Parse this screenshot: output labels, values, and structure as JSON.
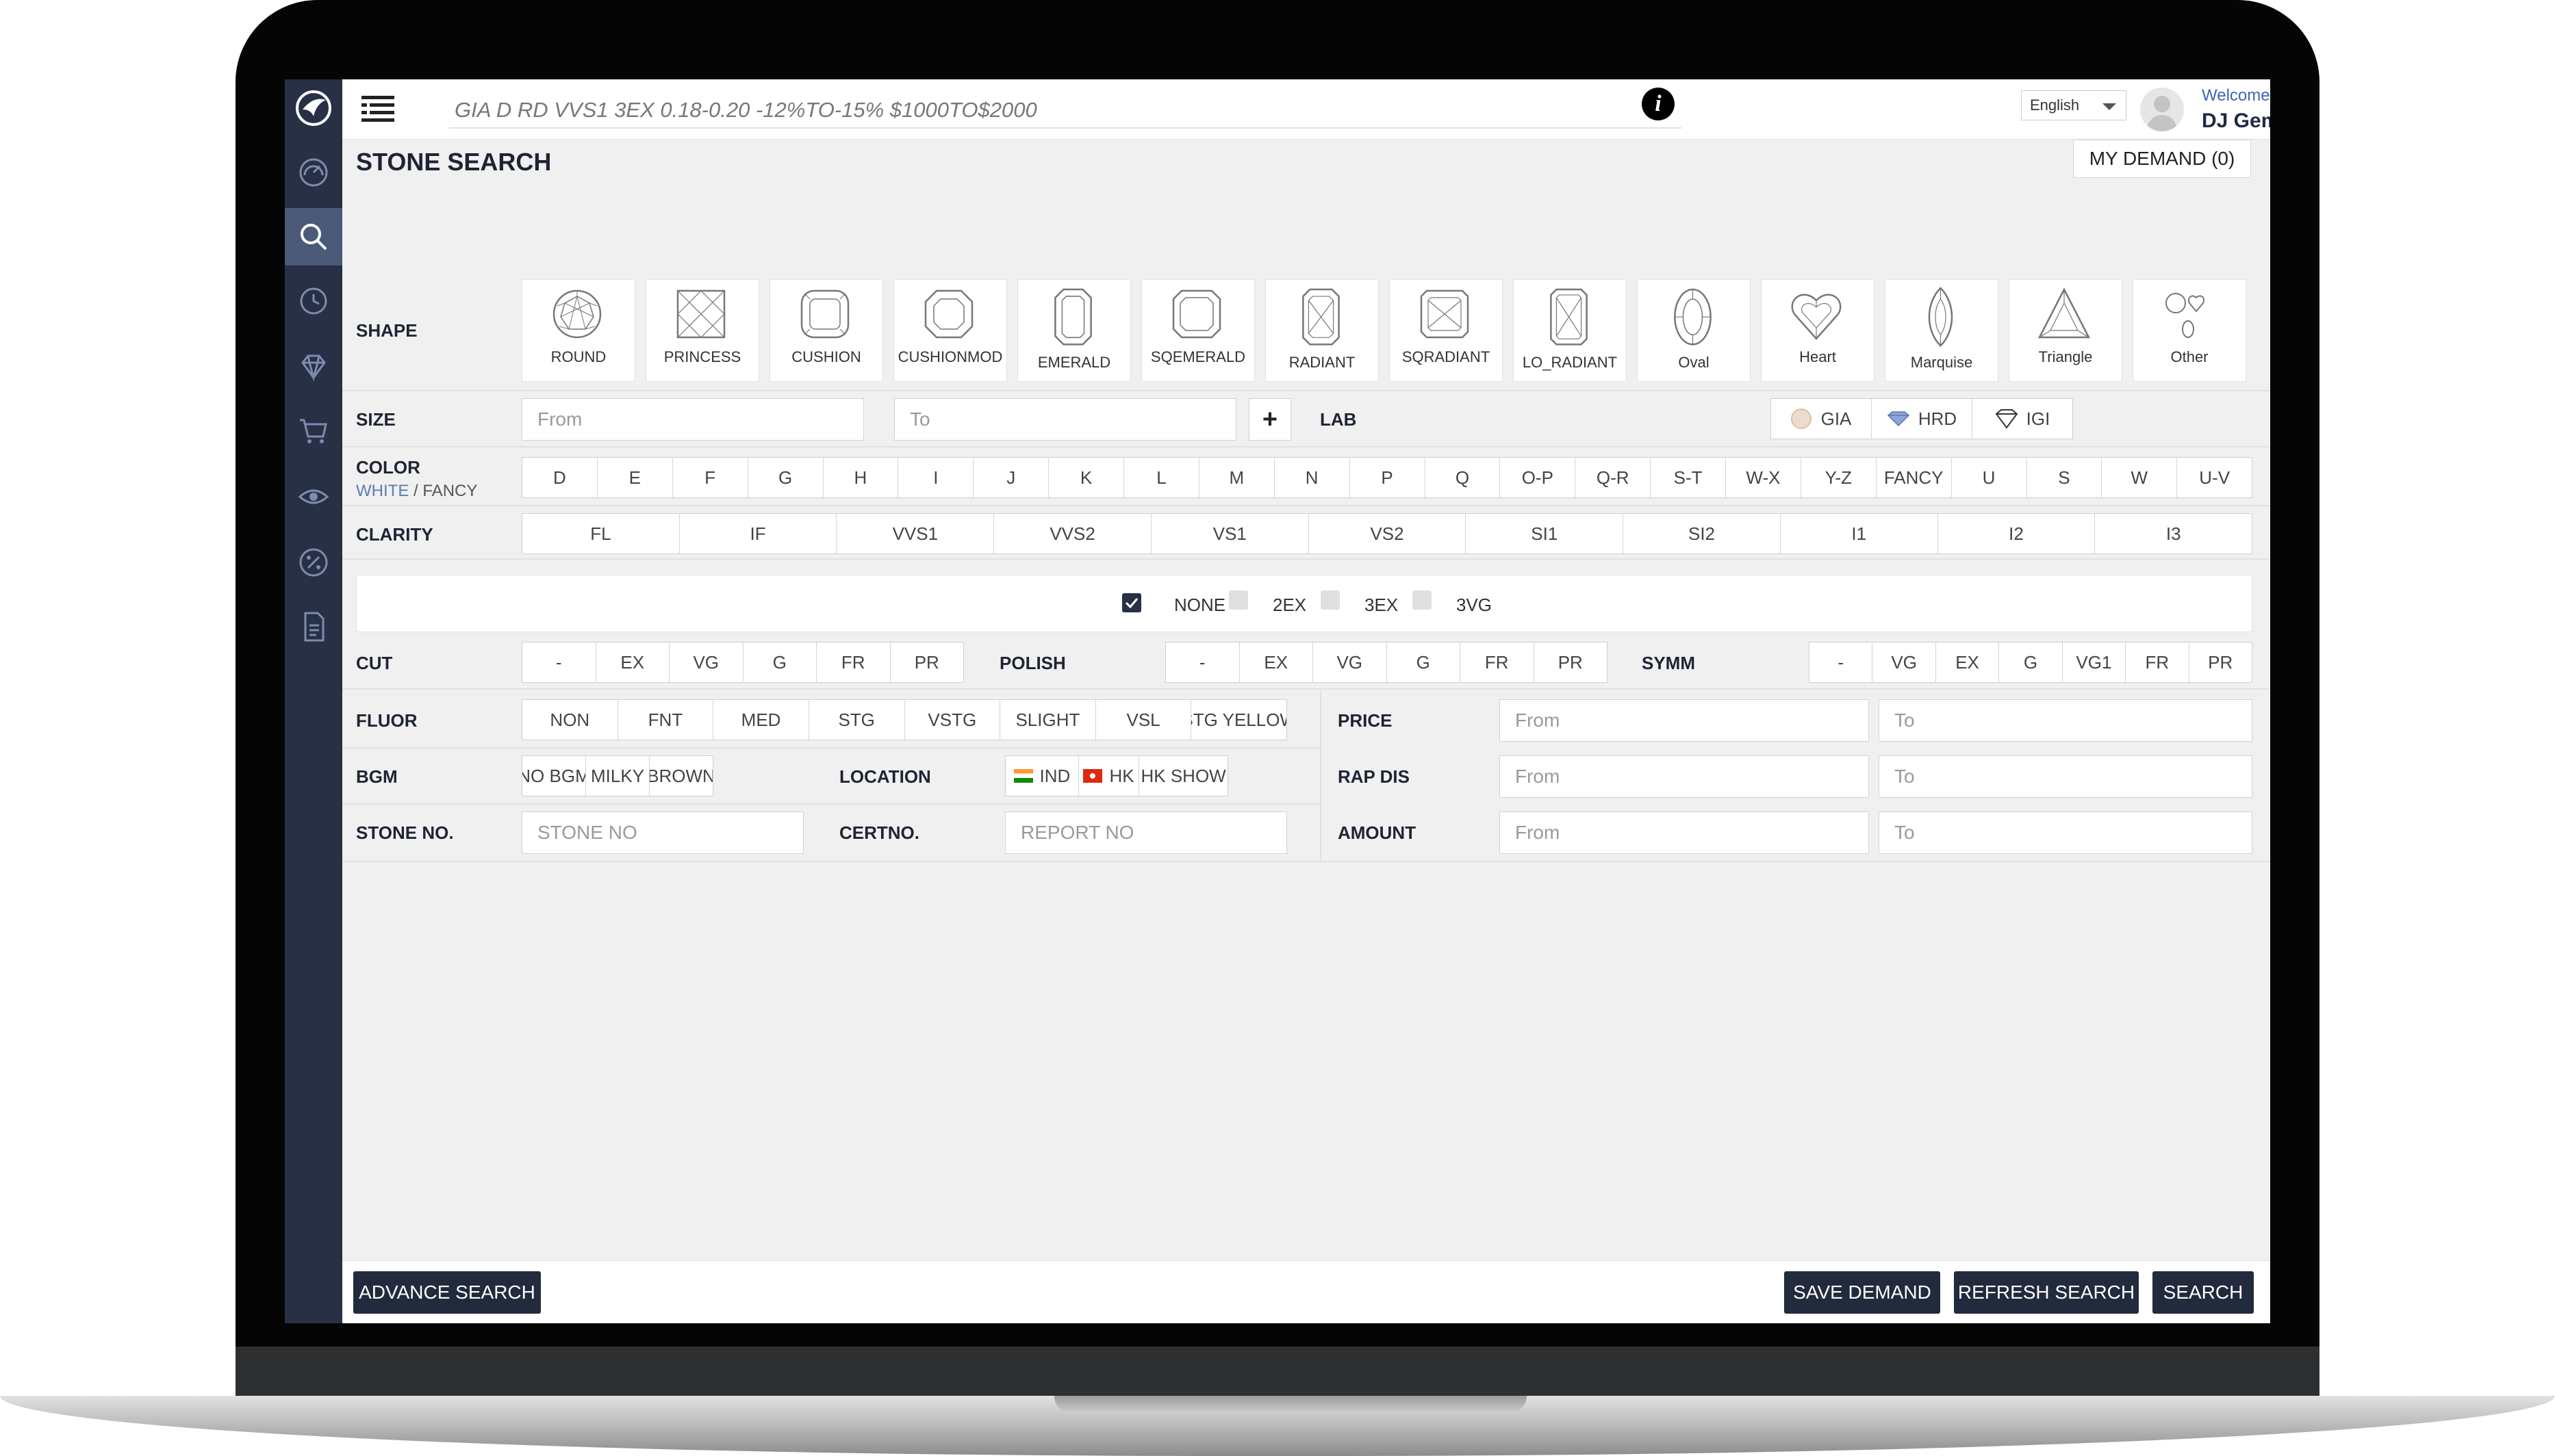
{
  "header": {
    "quick_search_placeholder": "GIA D RD VVS1 3EX 0.18-0.20 -12%TO-15% $1000TO$2000",
    "language": "English",
    "welcome": "Welcome",
    "user_name": "DJ Gems"
  },
  "sidebar": {
    "items": [
      {
        "icon": "dashboard-icon"
      },
      {
        "icon": "search-icon",
        "active": true
      },
      {
        "icon": "history-icon"
      },
      {
        "icon": "diamond-icon"
      },
      {
        "icon": "cart-icon"
      },
      {
        "icon": "eye-icon"
      },
      {
        "icon": "discount-icon"
      },
      {
        "icon": "document-icon"
      }
    ]
  },
  "page": {
    "title": "STONE SEARCH",
    "my_demand": "MY DEMAND (0)"
  },
  "shape": {
    "label": "SHAPE",
    "items": [
      "ROUND",
      "PRINCESS",
      "CUSHION",
      "CUSHIONMOD",
      "EMERALD",
      "SQEMERALD",
      "RADIANT",
      "SQRADIANT",
      "LO_RADIANT",
      "Oval",
      "Heart",
      "Marquise",
      "Triangle",
      "Other"
    ]
  },
  "size": {
    "label": "SIZE",
    "from_placeholder": "From",
    "to_placeholder": "To",
    "add": "+"
  },
  "lab": {
    "label": "LAB",
    "items": [
      "GIA",
      "HRD",
      "IGI"
    ]
  },
  "color": {
    "label": "COLOR",
    "white": "WHITE",
    "sep": "/",
    "fancy": "FANCY",
    "items": [
      "D",
      "E",
      "F",
      "G",
      "H",
      "I",
      "J",
      "K",
      "L",
      "M",
      "N",
      "P",
      "Q",
      "O-P",
      "Q-R",
      "S-T",
      "W-X",
      "Y-Z",
      "FANCY",
      "U",
      "S",
      "W",
      "U-V"
    ]
  },
  "clarity": {
    "label": "CLARITY",
    "items": [
      "FL",
      "IF",
      "VVS1",
      "VVS2",
      "VS1",
      "VS2",
      "SI1",
      "SI2",
      "I1",
      "I2",
      "I3"
    ]
  },
  "quick_checks": [
    {
      "label": "NONE",
      "checked": true
    },
    {
      "label": "2EX",
      "checked": false
    },
    {
      "label": "3EX",
      "checked": false
    },
    {
      "label": "3VG",
      "checked": false
    }
  ],
  "cut": {
    "label": "CUT",
    "items": [
      "-",
      "EX",
      "VG",
      "G",
      "FR",
      "PR"
    ]
  },
  "polish": {
    "label": "POLISH",
    "items": [
      "-",
      "EX",
      "VG",
      "G",
      "FR",
      "PR"
    ]
  },
  "symm": {
    "label": "SYMM",
    "items": [
      "-",
      "VG",
      "EX",
      "G",
      "VG1",
      "FR",
      "PR"
    ]
  },
  "fluor": {
    "label": "FLUOR",
    "items": [
      "NON",
      "FNT",
      "MED",
      "STG",
      "VSTG",
      "SLIGHT",
      "VSL",
      "STG YELLOW"
    ]
  },
  "bgm": {
    "label": "BGM",
    "items": [
      "NO BGM",
      "MILKY",
      "BROWN"
    ]
  },
  "location": {
    "label": "LOCATION",
    "items": [
      "IND",
      "HK",
      "HK SHOW"
    ]
  },
  "stone_no": {
    "label": "STONE NO.",
    "placeholder": "STONE NO"
  },
  "certno": {
    "label": "CERTNO.",
    "placeholder": "REPORT NO"
  },
  "price": {
    "label": "PRICE",
    "from_placeholder": "From",
    "to_placeholder": "To"
  },
  "rap_dis": {
    "label": "RAP DIS",
    "from_placeholder": "From",
    "to_placeholder": "To"
  },
  "amount": {
    "label": "AMOUNT",
    "from_placeholder": "From",
    "to_placeholder": "To"
  },
  "footer": {
    "advance_search": "ADVANCE SEARCH",
    "save_demand": "SAVE DEMAND",
    "refresh_search": "REFRESH SEARCH",
    "search": "SEARCH"
  },
  "colors": {
    "sidebar": "#273045",
    "active": "#4a5a78",
    "button": "#222a3d",
    "link": "#5a7cb5"
  }
}
